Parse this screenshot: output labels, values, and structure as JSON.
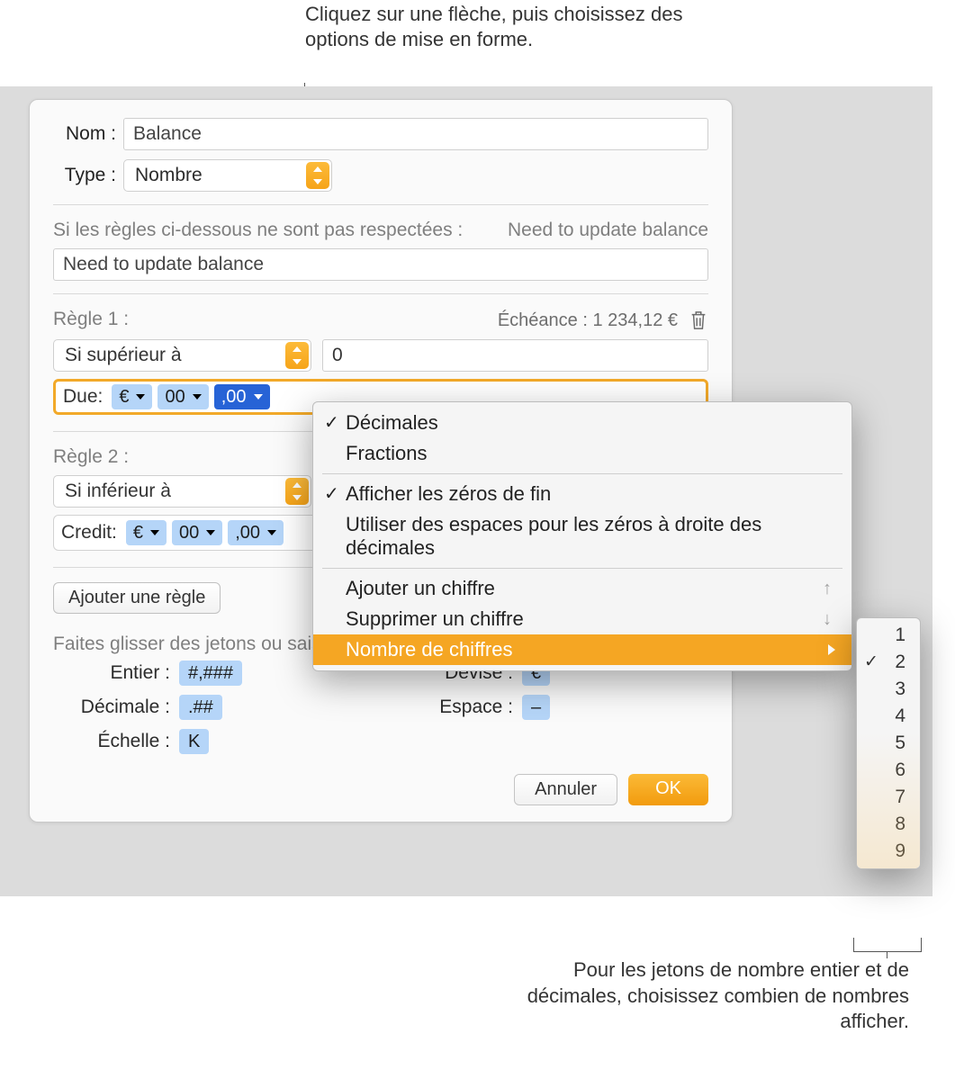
{
  "callouts": {
    "top": "Cliquez sur une flèche, puis choisissez des options de mise en forme.",
    "bottom": "Pour les jetons de nombre entier et de décimales, choisissez combien de nombres afficher."
  },
  "labels": {
    "name": "Nom :",
    "type": "Type :",
    "name_value": "Balance",
    "type_value": "Nombre",
    "rules_intro": "Si les règles ci-dessous ne sont pas respectées :",
    "rules_preview_text": "Need to update balance",
    "default_text_value": "Need to update balance",
    "rule1": "Règle 1 :",
    "rule1_preview": "Échéance : 1 234,12 €",
    "rule1_condition": "Si supérieur à",
    "rule1_value": "0",
    "format_due": "Due:",
    "token_currency": "€",
    "token_integer": "00",
    "token_decimal": ",00",
    "rule2": "Règle 2 :",
    "rule2_condition": "Si inférieur à",
    "format_credit": "Credit:",
    "token_decimal2": ",00",
    "add_rule": "Ajouter une règle",
    "drag_hint": "Faites glisser des jetons ou saisissez du texte dans le champ ci-dessus :",
    "tk_integer": "Entier :",
    "tk_integer_val": "#,###",
    "tk_decimal": "Décimale :",
    "tk_decimal_val": ".##",
    "tk_scale": "Échelle :",
    "tk_scale_val": "K",
    "tk_currency": "Devise :",
    "tk_currency_val": "€",
    "tk_space": "Espace :",
    "tk_space_val": "–",
    "cancel": "Annuler",
    "ok": "OK"
  },
  "popup": {
    "decimals": "Décimales",
    "fractions": "Fractions",
    "trailing_zeros": "Afficher les zéros de fin",
    "spaces_for_zeros": "Utiliser des espaces pour les zéros à droite des décimales",
    "add_digit": "Ajouter un chiffre",
    "remove_digit": "Supprimer un chiffre",
    "digit_count": "Nombre de chiffres"
  },
  "submenu": {
    "options": [
      "1",
      "2",
      "3",
      "4",
      "5",
      "6",
      "7",
      "8",
      "9"
    ],
    "selected": "2"
  }
}
